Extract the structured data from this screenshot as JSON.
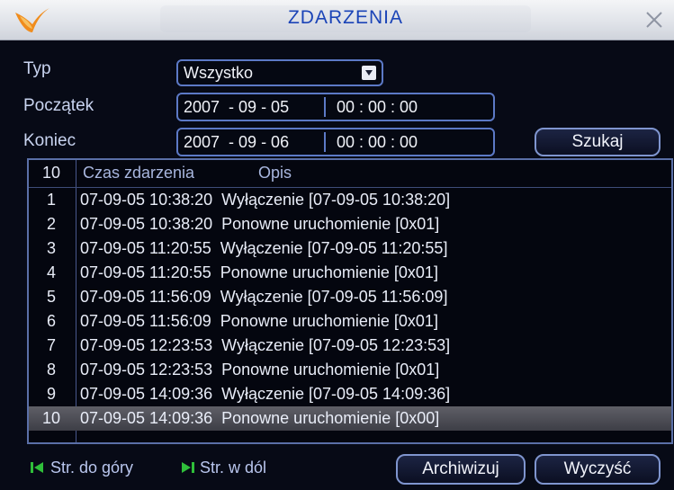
{
  "window": {
    "title": "ZDARZENIA"
  },
  "form": {
    "type_label": "Typ",
    "type_value": "Wszystko",
    "start_label": "Początek",
    "start_date": "2007  - 09 - 05",
    "start_time": "00 : 00 : 00",
    "end_label": "Koniec",
    "end_date": "2007  - 09 - 06",
    "end_time": "00 : 00 : 00",
    "search_label": "Szukaj"
  },
  "table": {
    "count": "10",
    "col_time": "Czas zdarzenia",
    "col_desc": "Opis",
    "rows": [
      {
        "num": "1",
        "text": "07-09-05 10:38:20  Wyłączenie [07-09-05 10:38:20]"
      },
      {
        "num": "2",
        "text": "07-09-05 10:38:20  Ponowne uruchomienie [0x01]"
      },
      {
        "num": "3",
        "text": "07-09-05 11:20:55  Wyłączenie [07-09-05 11:20:55]"
      },
      {
        "num": "4",
        "text": "07-09-05 11:20:55  Ponowne uruchomienie [0x01]"
      },
      {
        "num": "5",
        "text": "07-09-05 11:56:09  Wyłączenie [07-09-05 11:56:09]"
      },
      {
        "num": "6",
        "text": "07-09-05 11:56:09  Ponowne uruchomienie [0x01]"
      },
      {
        "num": "7",
        "text": "07-09-05 12:23:53  Wyłączenie [07-09-05 12:23:53]"
      },
      {
        "num": "8",
        "text": "07-09-05 12:23:53  Ponowne uruchomienie [0x01]"
      },
      {
        "num": "9",
        "text": "07-09-05 14:09:36  Wyłączenie [07-09-05 14:09:36]"
      },
      {
        "num": "10",
        "text": "07-09-05 14:09:36  Ponowne uruchomienie [0x00]"
      }
    ]
  },
  "footer": {
    "page_up": "Str. do góry",
    "page_down": "Str. w dól",
    "archive": "Archiwizuj",
    "clear": "Wyczyść"
  },
  "colors": {
    "title": "#1b44b7",
    "border": "#5c79c6",
    "nav_icon": "#2fbf3a"
  },
  "icons": [
    "logo-icon",
    "close-icon",
    "dropdown-arrow-icon",
    "page-up-icon",
    "page-down-icon"
  ]
}
